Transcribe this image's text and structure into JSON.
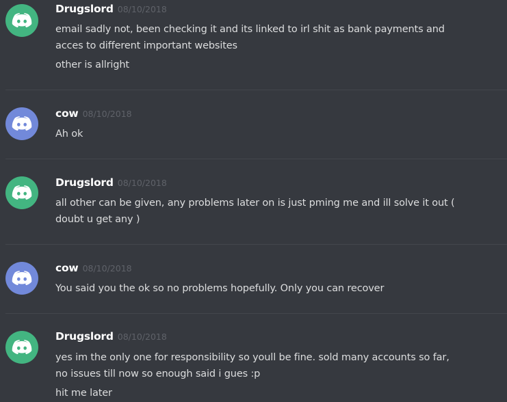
{
  "colors": {
    "background": "#36393f",
    "avatar_green": "#43b581",
    "avatar_blurple": "#7289da",
    "username": "#ffffff",
    "timestamp": "#5f6269",
    "message_text": "#dcddde"
  },
  "messages": [
    {
      "author": "Drugslord",
      "timestamp": "08/10/2018",
      "avatar_icon": "discord-logo-icon",
      "avatar_color": "green",
      "lines": [
        "email sadly not, been checking it and its linked to irl shit as bank payments and",
        "acces to different important websites",
        "other is allright"
      ]
    },
    {
      "author": "cow",
      "timestamp": "08/10/2018",
      "avatar_icon": "discord-logo-icon",
      "avatar_color": "blurple",
      "lines": [
        "Ah ok"
      ]
    },
    {
      "author": "Drugslord",
      "timestamp": "08/10/2018",
      "avatar_icon": "discord-logo-icon",
      "avatar_color": "green",
      "lines": [
        "all other can be given, any problems later on is just pming me and ill solve it out (",
        "doubt u get any )"
      ]
    },
    {
      "author": "cow",
      "timestamp": "08/10/2018",
      "avatar_icon": "discord-logo-icon",
      "avatar_color": "blurple",
      "lines": [
        "You said you the ok so no problems hopefully. Only you  can recover"
      ]
    },
    {
      "author": "Drugslord",
      "timestamp": "08/10/2018",
      "avatar_icon": "discord-logo-icon",
      "avatar_color": "green",
      "lines": [
        "yes im the only one for responsibility so youll be fine. sold many accounts so far,",
        "no issues till now so enough said i gues :p",
        "hit me later"
      ]
    }
  ]
}
